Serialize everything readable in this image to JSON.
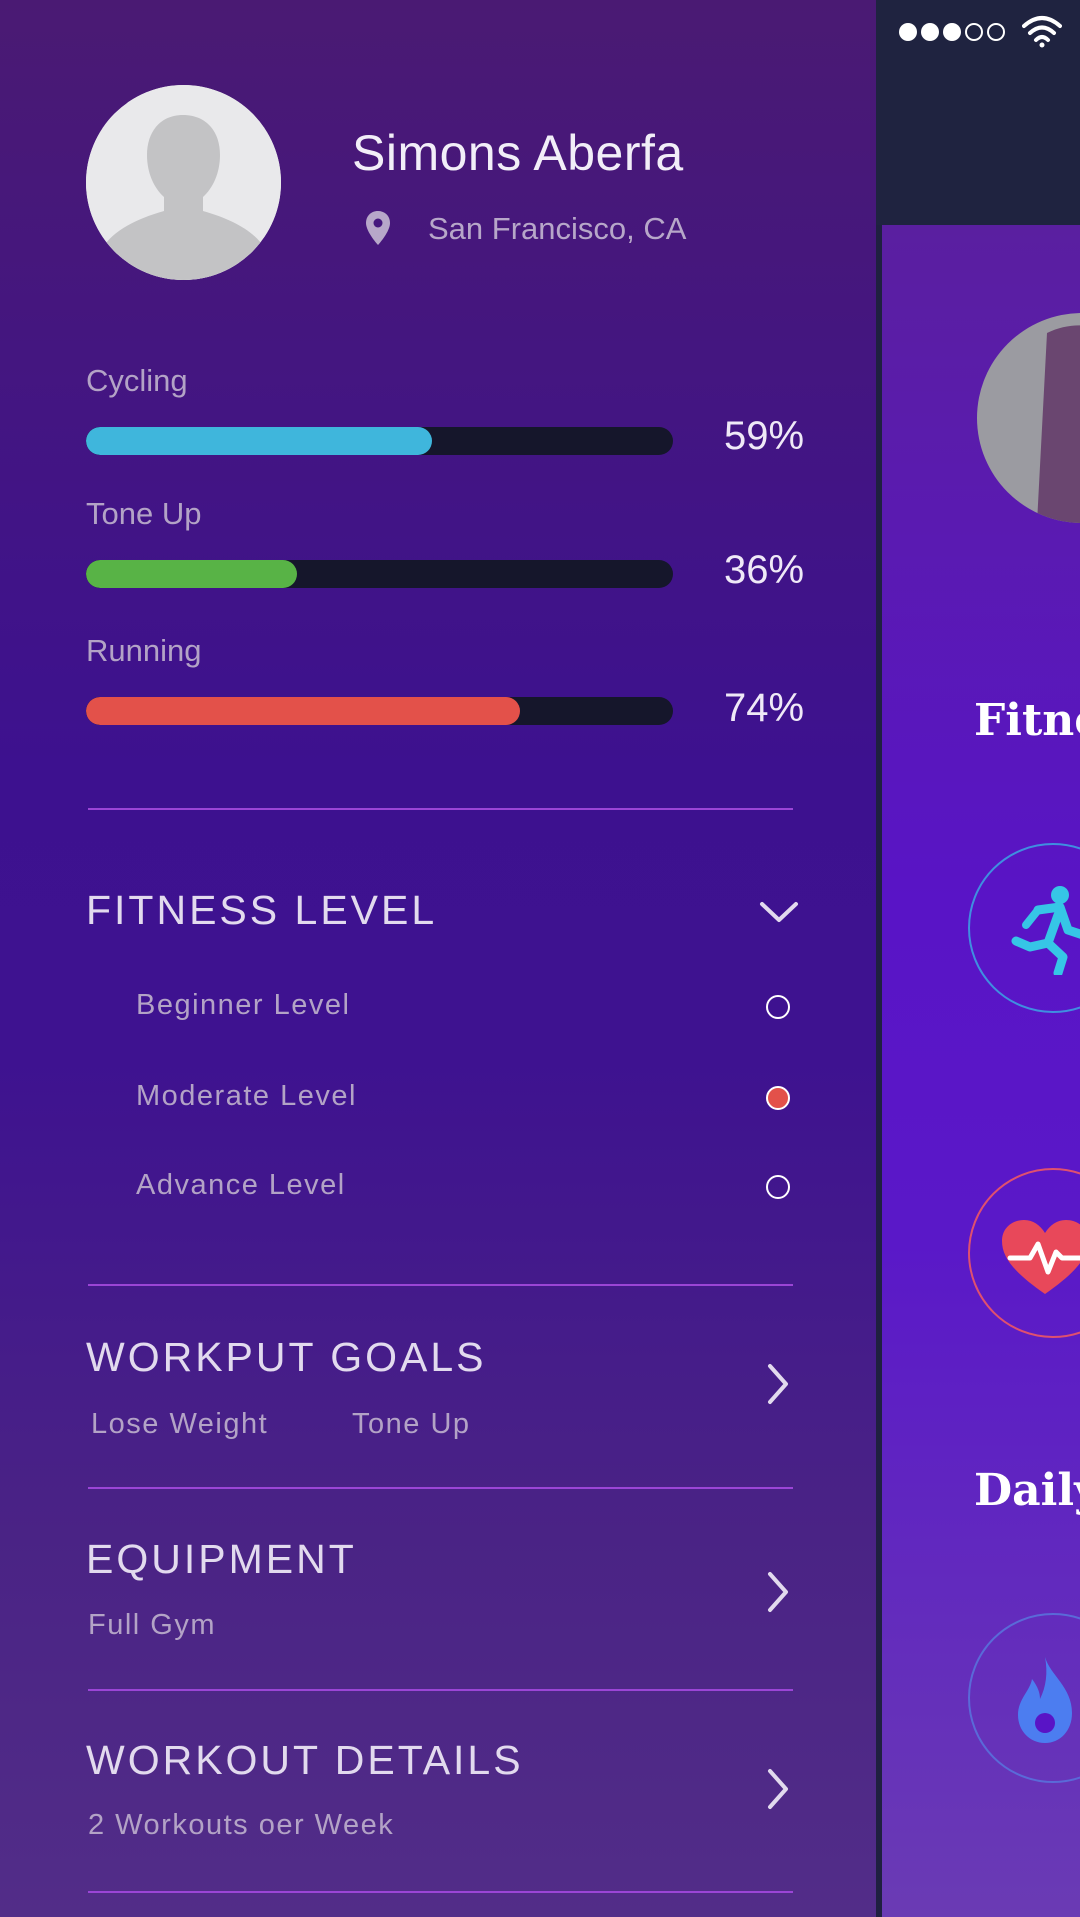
{
  "profile": {
    "name": "Simons Aberfa",
    "location": "San Francisco, CA"
  },
  "stats": [
    {
      "label": "Cycling",
      "percent_text": "59%",
      "value": 59,
      "color": "#3fb6dc"
    },
    {
      "label": "Tone Up",
      "percent_text": "36%",
      "value": 36,
      "color": "#58b346"
    },
    {
      "label": "Running",
      "percent_text": "74%",
      "value": 74,
      "color": "#e3514a"
    }
  ],
  "fitness_level": {
    "title": "FITNESS LEVEL",
    "options": [
      {
        "label": "Beginner Level",
        "selected": false
      },
      {
        "label": "Moderate Level",
        "selected": true
      },
      {
        "label": "Advance Level",
        "selected": false
      }
    ]
  },
  "workout_goals": {
    "title": "WORKPUT GOALS",
    "items": [
      "Lose Weight",
      "Tone Up"
    ]
  },
  "equipment": {
    "title": "EQUIPMENT",
    "value": "Full Gym"
  },
  "workout_details": {
    "title": "WORKOUT DETAILS",
    "value": "2 Workouts oer Week"
  },
  "background_screen": {
    "heading_1": "Fitne",
    "heading_2": "Daily"
  },
  "colors": {
    "divider": "#9b45d6",
    "accent_red": "#e3514a",
    "bar_track": "#15162b"
  },
  "icons": [
    "location-pin-icon",
    "chevron-down-icon",
    "chevron-right-icon",
    "running-icon",
    "heart-pulse-icon",
    "flame-icon",
    "wifi-icon",
    "signal-icon"
  ]
}
